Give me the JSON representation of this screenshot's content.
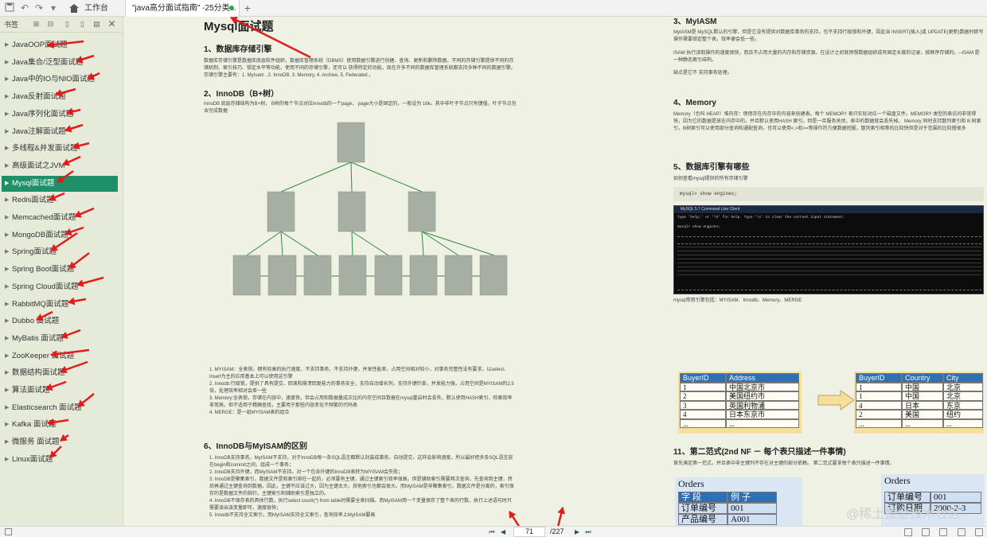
{
  "tabbar": {
    "home_label": "工作台",
    "doc_label": "\"java高分面试指南\" -25分类...",
    "plus": "+"
  },
  "sidebar": {
    "title": "书签",
    "items": [
      {
        "label": "JavaOOP面试题"
      },
      {
        "label": "Java集合/泛型面试题"
      },
      {
        "label": "Java中的IO与NIO面试题"
      },
      {
        "label": "Java反射面试题"
      },
      {
        "label": "Java序列化面试题"
      },
      {
        "label": "Java注解面试题"
      },
      {
        "label": "多线程&并发面试题"
      },
      {
        "label": "高级面试之JVM"
      },
      {
        "label": "Mysql面试题"
      },
      {
        "label": "Redis面试题"
      },
      {
        "label": "Memcached面试题"
      },
      {
        "label": "MongoDB面试题"
      },
      {
        "label": "Spring面试题"
      },
      {
        "label": "Spring Boot面试题"
      },
      {
        "label": "Spring Cloud面试题"
      },
      {
        "label": "RabbitMQ面试题"
      },
      {
        "label": "Dubbo 面试题"
      },
      {
        "label": "MyBatis 面试题"
      },
      {
        "label": "ZooKeeper 面试题"
      },
      {
        "label": "数据结构面试题"
      },
      {
        "label": "算法面试题"
      },
      {
        "label": "Elasticsearch 面试题"
      },
      {
        "label": "Kafka 面试题"
      },
      {
        "label": "微服务 面试题"
      },
      {
        "label": "Linux面试题"
      }
    ],
    "active_index": 8
  },
  "left_page": {
    "title": "Mysql面试题",
    "s1_heading": "1、数据库存储引擎",
    "s1_text": "数据库存储引擎是数据库底层软件组织，数据库管理系统（DBMS）使用数据引擎进行创建、查询、更新和删除数据。不同的存储引擎提供不同的存储机制、索引技巧、锁定水平等功能，使用不同的存储引擎，还可以 获得特定的功能。现在许多不同的数据库管理系统都支持多种不同的数据引擎。存储引擎主要有：1. MyIsam , 2. InnoDB, 3. Memory, 4. Archive, 5. Federated 。",
    "s2_heading": "2、InnoDB（B+树）",
    "s2_text": "InnoDB 底层存储结构为B+树， B树的每个节点对应innodb的一个page， page大小是固定的，一般设为 16k。其中非叶子节点只有键值，叶子节点包含完成数据",
    "list1": [
      "MYISAM：全表锁，拥有较高的执行速度，不支持事务，不支持外键，并发性能差，占用空间相对较小，对事务完整性没有要求，以select、insert为主的应用基本上可以使用这引擎",
      "Innodb:行级锁，提供了具有提交、回滚和崩溃回复能力的事务安全，支持自动增长列，支持外键约束，并发能力强，占用空间是MYISAM的2.5倍，处理效率相对会差一些",
      "Memory:全表锁，存储在内容中，速度快，但会占用和数据量成正比的内存空间且数据在mysql重启时会丢失，默认使用HASH索引，检索效率非常高，但不适用于精确查找，主要用于那些内容变化不频繁的代码表",
      "MERGE：是一组MYISAM表的组合"
    ],
    "s6_heading": "6、InnoDB与MyISAM的区别",
    "list2": [
      "InnoDB支持事务，MyISAM不支持，对于InnoDB每一条SQL语言都默认封装成事务，自动提交，这样会影响速度，所以最好把多条SQL语言放在begin和commit之间，组成一个事务；",
      "InnoDB支持外键，而MyISAM不支持。对一个包含外键的InnoDB表转为MYISAM会失败；",
      "InnoDB是聚集索引，数据文件是和索引绑在一起的，必须要有主键，通过主键索引效率很高。但是辅助索引需要两次查询，先查询到主键，然后再通过主键查询到数据。因此，主键不应该过大，因为主键太大，其他索引也都会很大。而MyISAM是非聚集索引，数据文件是分离的，索引保存的是数据文件的指针。主键索引和辅助索引是独立的。",
      "InnoDB不保存表的具体行数，执行select count(*) from table时需要全表扫描。而MyISAM用一个变量保存了整个表的行数，执行上述语句时只需要读出该变量即可，速度很快；",
      "Innodb不支持全文索引，而MyISAM支持全文索引，查询效率上MyISAM要高"
    ]
  },
  "right_page": {
    "s3_heading": "3、MyIASM",
    "s3_text1": "MyIASM是 MySQL默认的引擎，但是它没有提供对数据库事务的支持，也不支持行级锁和外键，因此当 INSERT(插入)或 UPDATE(更新)数据时即写操作需要锁定整个表，效率便会低一些。",
    "s3_text2": "ISAM 执行读取操作的速度很快，而且不占用大量的内存和存储资源。在设计之初就预想数据组织成有固定长度的记录，按顺序存储的。--ISAM 是一种静态索引结构。",
    "s3_text3": "缺点是它不 支持事务处理。",
    "s4_heading": "4、Memory",
    "s4_text": "Memory（也叫 HEAP）堆内存：使用存在内存中的内容来创建表。每个 MEMORY 表只实际对应一个磁盘文件。MEMORY 类型的表访问非常得快，因为它的数据是放在内存中的，并且默认使用HASH 索引。但是一旦服务关闭，表中的数据就会丢失掉。 Memory 同时支持散列索引和 B 树索引，B树索引可以使用部分查询和通配查询，也可以使用<,>和>=等操作符方便数据挖掘，散列索引相等的比较快但是对于范围的比较慢很多",
    "s5_heading": "5、数据库引擎有哪些",
    "s5_text": "如何查看mysql提供的所有存储引擎",
    "code": "mysql> show engines;",
    "console_title": "MySQL 5.7 Command Line Client",
    "console_line1": "Type 'help;' or '\\h' for help. Type '\\c' to clear the current input statement.",
    "console_line2": "mysql> show engines;",
    "engines_caption": "mysql常用引擎包括：MYISAM、Innodb、Memory、MERGE",
    "table1": {
      "headers": [
        "BuyerID",
        "Address"
      ],
      "rows": [
        [
          "1",
          "中国北京市"
        ],
        [
          "2",
          "美国纽约市"
        ],
        [
          "3",
          "英国利物浦"
        ],
        [
          "4",
          "日本东京市"
        ],
        [
          "...",
          "..."
        ]
      ]
    },
    "table2": {
      "headers": [
        "BuyerID",
        "Country",
        "City"
      ],
      "rows": [
        [
          "1",
          "中国",
          "北京"
        ],
        [
          "1",
          "中国",
          "北京"
        ],
        [
          "4",
          "日本",
          "东京"
        ],
        [
          "2",
          "美国",
          "纽约"
        ],
        [
          "...",
          "...",
          "..."
        ]
      ]
    },
    "s11_heading": "11、第二范式(2nd NF － 每个表只描述一件事情)",
    "s11_text": "首先满足第一范式，并且表中非主键列不存在对主键的部分依赖。 第二范式要求每个表只描述一件事情。",
    "orders_left": {
      "title": "Orders",
      "headers": [
        "字 段",
        "例 子"
      ],
      "rows": [
        [
          "订单编号",
          "001"
        ],
        [
          "产品编号",
          "A001"
        ]
      ]
    },
    "orders_right": {
      "title": "Orders",
      "rows": [
        [
          "订单编号",
          "001"
        ],
        [
          "订购日期",
          "2000-2-3"
        ]
      ]
    }
  },
  "statusbar": {
    "page_value": "71",
    "page_total": "/227"
  },
  "watermark": "@稀土掘金技术社区",
  "colors": {
    "accent": "#1f8f6a",
    "page_bg": "#eef1e3",
    "tree_node": "#a7aea3",
    "tree_edge": "#2e8b3d",
    "annotation": "#e31b1b"
  }
}
